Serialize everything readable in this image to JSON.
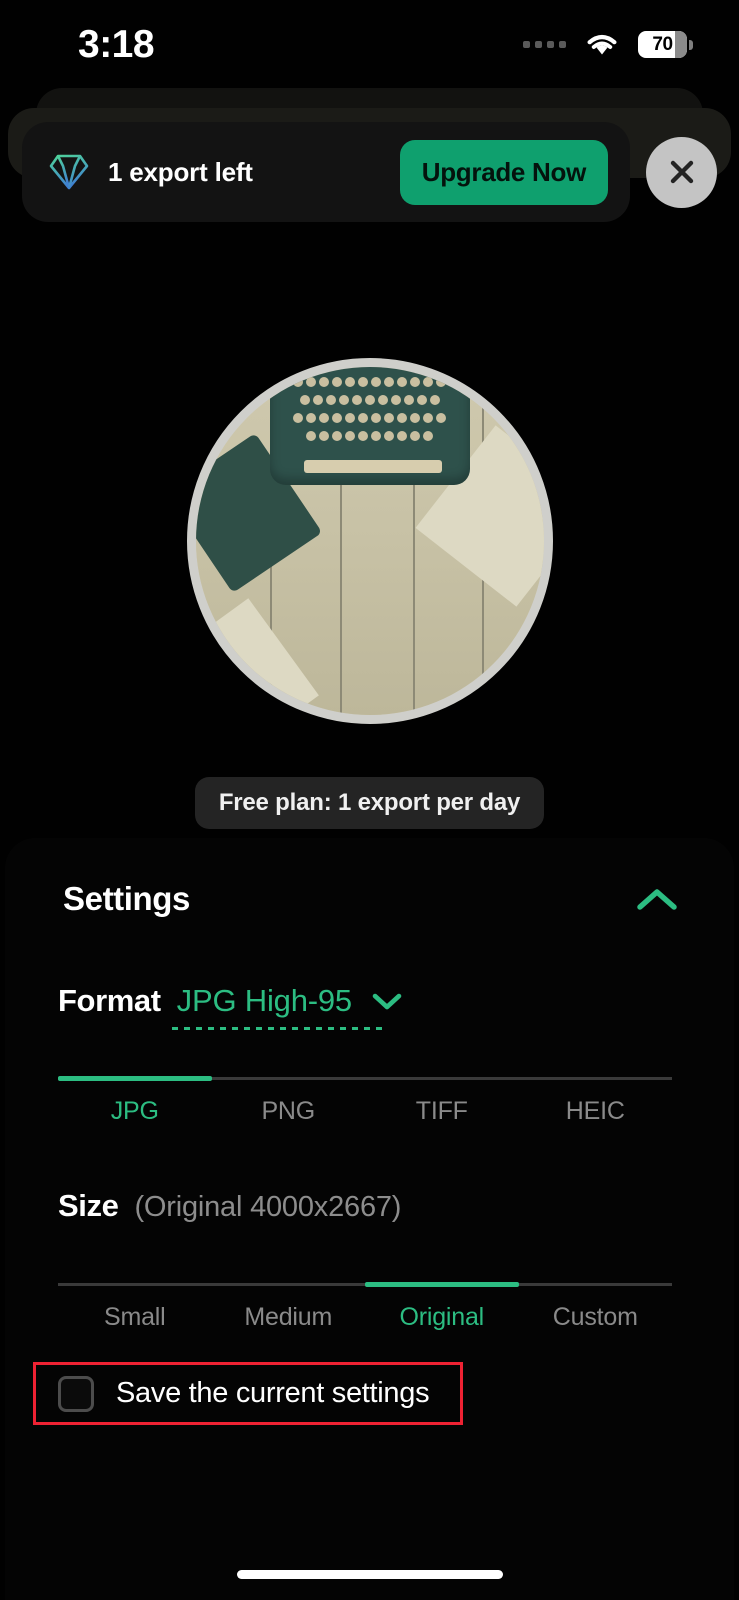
{
  "status_bar": {
    "time": "3:18",
    "cellular_icon": "cellular-dots-icon",
    "wifi_icon": "wifi-icon",
    "battery_percent": "70"
  },
  "banner": {
    "gem_icon": "diamond-icon",
    "message": "1 export left",
    "upgrade_label": "Upgrade Now",
    "close_icon": "close-icon"
  },
  "preview": {
    "alt": "circular photo preview of a teal typewriter on wooden planks",
    "plan_note": "Free plan: 1 export per day"
  },
  "settings": {
    "title": "Settings",
    "collapse_icon": "chevron-up-icon",
    "format": {
      "label": "Format",
      "selected_value": "JPG High-95",
      "dropdown_icon": "chevron-down-icon",
      "tabs": [
        {
          "label": "JPG",
          "active": true
        },
        {
          "label": "PNG",
          "active": false
        },
        {
          "label": "TIFF",
          "active": false
        },
        {
          "label": "HEIC",
          "active": false
        }
      ]
    },
    "size": {
      "label": "Size",
      "detail": "(Original 4000x2667)",
      "tabs": [
        {
          "label": "Small",
          "active": false
        },
        {
          "label": "Medium",
          "active": false
        },
        {
          "label": "Original",
          "active": true
        },
        {
          "label": "Custom",
          "active": false
        }
      ]
    },
    "save_settings": {
      "label": "Save the current settings",
      "checked": false
    }
  },
  "colors": {
    "accent_green": "#2cbd82",
    "button_green": "#0fa06e",
    "annotation_red": "#ee2233",
    "background": "#000000"
  }
}
